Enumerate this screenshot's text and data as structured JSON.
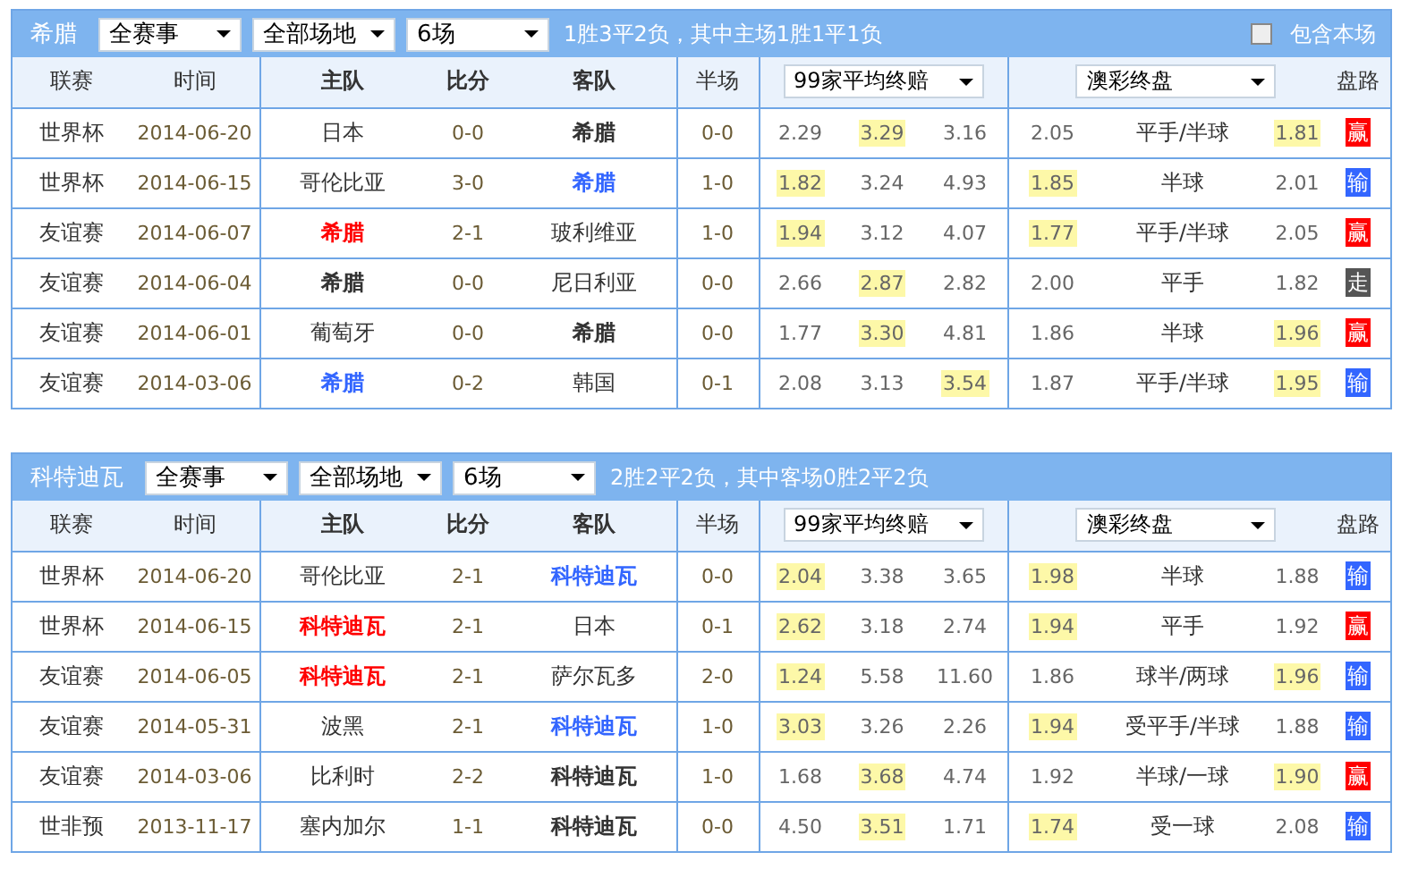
{
  "panels": [
    {
      "team": "希腊",
      "filters": [
        "全赛事",
        "全部场地",
        "6场"
      ],
      "summary": "1胜3平2负，其中主场1胜1平1负",
      "include_option": {
        "label": "包含本场",
        "checked": false
      },
      "columns": [
        "联赛",
        "时间",
        "主队",
        "比分",
        "客队",
        "半场",
        "盘路"
      ],
      "odds_select": "99家平均终赔",
      "handicap_select": "澳彩终盘",
      "rows": [
        {
          "league": "世界杯",
          "date": "2014-06-20",
          "home": {
            "name": "日本",
            "kind": "other"
          },
          "score": "0-0",
          "away": {
            "name": "希腊",
            "kind": "draw"
          },
          "half": "0-0",
          "odds": [
            {
              "value": "2.29",
              "highlighted": false
            },
            {
              "value": "3.29",
              "highlighted": true
            },
            {
              "value": "3.16",
              "highlighted": false
            }
          ],
          "hc_home": {
            "value": "2.05",
            "highlighted": false
          },
          "line": "平手/半球",
          "hc_away": {
            "value": "1.81",
            "highlighted": true
          },
          "result": {
            "label": "赢",
            "color": "#ff0000"
          }
        },
        {
          "league": "世界杯",
          "date": "2014-06-15",
          "home": {
            "name": "哥伦比亚",
            "kind": "other"
          },
          "score": "3-0",
          "away": {
            "name": "希腊",
            "kind": "loss"
          },
          "half": "1-0",
          "odds": [
            {
              "value": "1.82",
              "highlighted": true
            },
            {
              "value": "3.24",
              "highlighted": false
            },
            {
              "value": "4.93",
              "highlighted": false
            }
          ],
          "hc_home": {
            "value": "1.85",
            "highlighted": true
          },
          "line": "半球",
          "hc_away": {
            "value": "2.01",
            "highlighted": false
          },
          "result": {
            "label": "输",
            "color": "#3366ff"
          }
        },
        {
          "league": "友谊赛",
          "date": "2014-06-07",
          "home": {
            "name": "希腊",
            "kind": "win"
          },
          "score": "2-1",
          "away": {
            "name": "玻利维亚",
            "kind": "other"
          },
          "half": "1-0",
          "odds": [
            {
              "value": "1.94",
              "highlighted": true
            },
            {
              "value": "3.12",
              "highlighted": false
            },
            {
              "value": "4.07",
              "highlighted": false
            }
          ],
          "hc_home": {
            "value": "1.77",
            "highlighted": true
          },
          "line": "平手/半球",
          "hc_away": {
            "value": "2.05",
            "highlighted": false
          },
          "result": {
            "label": "赢",
            "color": "#ff0000"
          }
        },
        {
          "league": "友谊赛",
          "date": "2014-06-04",
          "home": {
            "name": "希腊",
            "kind": "draw"
          },
          "score": "0-0",
          "away": {
            "name": "尼日利亚",
            "kind": "other"
          },
          "half": "0-0",
          "odds": [
            {
              "value": "2.66",
              "highlighted": false
            },
            {
              "value": "2.87",
              "highlighted": true
            },
            {
              "value": "2.82",
              "highlighted": false
            }
          ],
          "hc_home": {
            "value": "2.00",
            "highlighted": false
          },
          "line": "平手",
          "hc_away": {
            "value": "1.82",
            "highlighted": false
          },
          "result": {
            "label": "走",
            "color": "#555555"
          }
        },
        {
          "league": "友谊赛",
          "date": "2014-06-01",
          "home": {
            "name": "葡萄牙",
            "kind": "other"
          },
          "score": "0-0",
          "away": {
            "name": "希腊",
            "kind": "draw"
          },
          "half": "0-0",
          "odds": [
            {
              "value": "1.77",
              "highlighted": false
            },
            {
              "value": "3.30",
              "highlighted": true
            },
            {
              "value": "4.81",
              "highlighted": false
            }
          ],
          "hc_home": {
            "value": "1.86",
            "highlighted": false
          },
          "line": "半球",
          "hc_away": {
            "value": "1.96",
            "highlighted": true
          },
          "result": {
            "label": "赢",
            "color": "#ff0000"
          }
        },
        {
          "league": "友谊赛",
          "date": "2014-03-06",
          "home": {
            "name": "希腊",
            "kind": "loss"
          },
          "score": "0-2",
          "away": {
            "name": "韩国",
            "kind": "other"
          },
          "half": "0-1",
          "odds": [
            {
              "value": "2.08",
              "highlighted": false
            },
            {
              "value": "3.13",
              "highlighted": false
            },
            {
              "value": "3.54",
              "highlighted": true
            }
          ],
          "hc_home": {
            "value": "1.87",
            "highlighted": false
          },
          "line": "平手/半球",
          "hc_away": {
            "value": "1.95",
            "highlighted": true
          },
          "result": {
            "label": "输",
            "color": "#3366ff"
          }
        }
      ]
    },
    {
      "team": "科特迪瓦",
      "filters": [
        "全赛事",
        "全部场地",
        "6场"
      ],
      "summary": "2胜2平2负，其中客场0胜2平2负",
      "columns": [
        "联赛",
        "时间",
        "主队",
        "比分",
        "客队",
        "半场",
        "盘路"
      ],
      "odds_select": "99家平均终赔",
      "handicap_select": "澳彩终盘",
      "rows": [
        {
          "league": "世界杯",
          "date": "2014-06-20",
          "home": {
            "name": "哥伦比亚",
            "kind": "other"
          },
          "score": "2-1",
          "away": {
            "name": "科特迪瓦",
            "kind": "loss"
          },
          "half": "0-0",
          "odds": [
            {
              "value": "2.04",
              "highlighted": true
            },
            {
              "value": "3.38",
              "highlighted": false
            },
            {
              "value": "3.65",
              "highlighted": false
            }
          ],
          "hc_home": {
            "value": "1.98",
            "highlighted": true
          },
          "line": "半球",
          "hc_away": {
            "value": "1.88",
            "highlighted": false
          },
          "result": {
            "label": "输",
            "color": "#3366ff"
          }
        },
        {
          "league": "世界杯",
          "date": "2014-06-15",
          "home": {
            "name": "科特迪瓦",
            "kind": "win"
          },
          "score": "2-1",
          "away": {
            "name": "日本",
            "kind": "other"
          },
          "half": "0-1",
          "odds": [
            {
              "value": "2.62",
              "highlighted": true
            },
            {
              "value": "3.18",
              "highlighted": false
            },
            {
              "value": "2.74",
              "highlighted": false
            }
          ],
          "hc_home": {
            "value": "1.94",
            "highlighted": true
          },
          "line": "平手",
          "hc_away": {
            "value": "1.92",
            "highlighted": false
          },
          "result": {
            "label": "赢",
            "color": "#ff0000"
          }
        },
        {
          "league": "友谊赛",
          "date": "2014-06-05",
          "home": {
            "name": "科特迪瓦",
            "kind": "win"
          },
          "score": "2-1",
          "away": {
            "name": "萨尔瓦多",
            "kind": "other"
          },
          "half": "2-0",
          "odds": [
            {
              "value": "1.24",
              "highlighted": true
            },
            {
              "value": "5.58",
              "highlighted": false
            },
            {
              "value": "11.60",
              "highlighted": false
            }
          ],
          "hc_home": {
            "value": "1.86",
            "highlighted": false
          },
          "line": "球半/两球",
          "hc_away": {
            "value": "1.96",
            "highlighted": true
          },
          "result": {
            "label": "输",
            "color": "#3366ff"
          }
        },
        {
          "league": "友谊赛",
          "date": "2014-05-31",
          "home": {
            "name": "波黑",
            "kind": "other"
          },
          "score": "2-1",
          "away": {
            "name": "科特迪瓦",
            "kind": "loss"
          },
          "half": "1-0",
          "odds": [
            {
              "value": "3.03",
              "highlighted": true
            },
            {
              "value": "3.26",
              "highlighted": false
            },
            {
              "value": "2.26",
              "highlighted": false
            }
          ],
          "hc_home": {
            "value": "1.94",
            "highlighted": true
          },
          "line": "受平手/半球",
          "hc_away": {
            "value": "1.88",
            "highlighted": false
          },
          "result": {
            "label": "输",
            "color": "#3366ff"
          }
        },
        {
          "league": "友谊赛",
          "date": "2014-03-06",
          "home": {
            "name": "比利时",
            "kind": "other"
          },
          "score": "2-2",
          "away": {
            "name": "科特迪瓦",
            "kind": "draw"
          },
          "half": "1-0",
          "odds": [
            {
              "value": "1.68",
              "highlighted": false
            },
            {
              "value": "3.68",
              "highlighted": true
            },
            {
              "value": "4.74",
              "highlighted": false
            }
          ],
          "hc_home": {
            "value": "1.92",
            "highlighted": false
          },
          "line": "半球/一球",
          "hc_away": {
            "value": "1.90",
            "highlighted": true
          },
          "result": {
            "label": "赢",
            "color": "#ff0000"
          }
        },
        {
          "league": "世非预",
          "date": "2013-11-17",
          "home": {
            "name": "塞内加尔",
            "kind": "other"
          },
          "score": "1-1",
          "away": {
            "name": "科特迪瓦",
            "kind": "draw"
          },
          "half": "0-0",
          "odds": [
            {
              "value": "4.50",
              "highlighted": false
            },
            {
              "value": "3.51",
              "highlighted": true
            },
            {
              "value": "1.71",
              "highlighted": false
            }
          ],
          "hc_home": {
            "value": "1.74",
            "highlighted": true
          },
          "line": "受一球",
          "hc_away": {
            "value": "2.08",
            "highlighted": false
          },
          "result": {
            "label": "输",
            "color": "#3366ff"
          }
        }
      ]
    }
  ]
}
